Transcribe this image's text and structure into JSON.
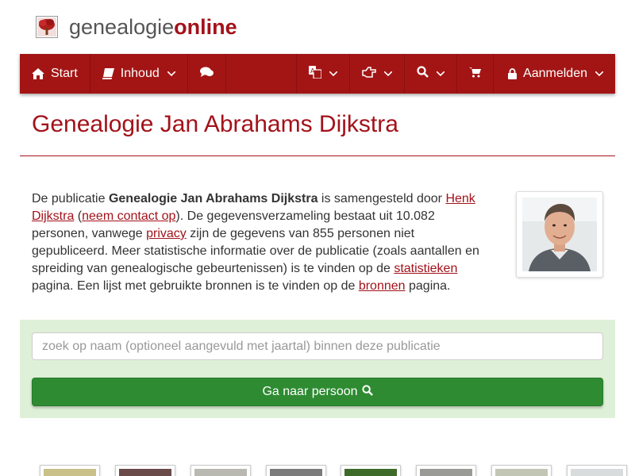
{
  "brand": {
    "name_plain": "genealogie",
    "name_bold": "online"
  },
  "nav": {
    "start_label": "Start",
    "inhoud_label": "Inhoud",
    "login_label": "Aanmelden"
  },
  "page": {
    "title": "Genealogie Jan Abrahams Dijkstra"
  },
  "intro": {
    "t1": "De publicatie ",
    "pub_name": "Genealogie Jan Abrahams Dijkstra",
    "t2": " is samengesteld door ",
    "author_link": "Henk Dijkstra",
    "t3": " (",
    "contact_link": "neem contact op",
    "t4": "). De gegevensverzameling bestaat uit 10.082 personen, vanwege ",
    "privacy_link": "privacy",
    "t5": " zijn de gegevens van 855 personen niet gepubliceerd. Meer statistische informatie over de publicatie (zoals aantallen en spreiding van genealogische gebeurtenissen) is te vinden op de ",
    "stats_link": "statistieken",
    "t6": " pagina. Een lijst met gebruikte bronnen is te vinden op de ",
    "sources_link": "bronnen",
    "t7": " pagina."
  },
  "search": {
    "placeholder": "zoek op naam (optioneel aangevuld met jaartal) binnen deze publicatie",
    "button_label": "Ga naar persoon"
  },
  "colors": {
    "brand_red": "#a3121a",
    "nav_bg": "#a31515",
    "search_panel_bg": "#dff0d8",
    "button_green": "#2e8b32"
  },
  "icons": [
    "tree-logo-icon",
    "home-icon",
    "book-icon",
    "comments-icon",
    "translate-icon",
    "hand-point-icon",
    "search-icon",
    "cart-icon",
    "lock-icon",
    "chevron-down-icon"
  ]
}
